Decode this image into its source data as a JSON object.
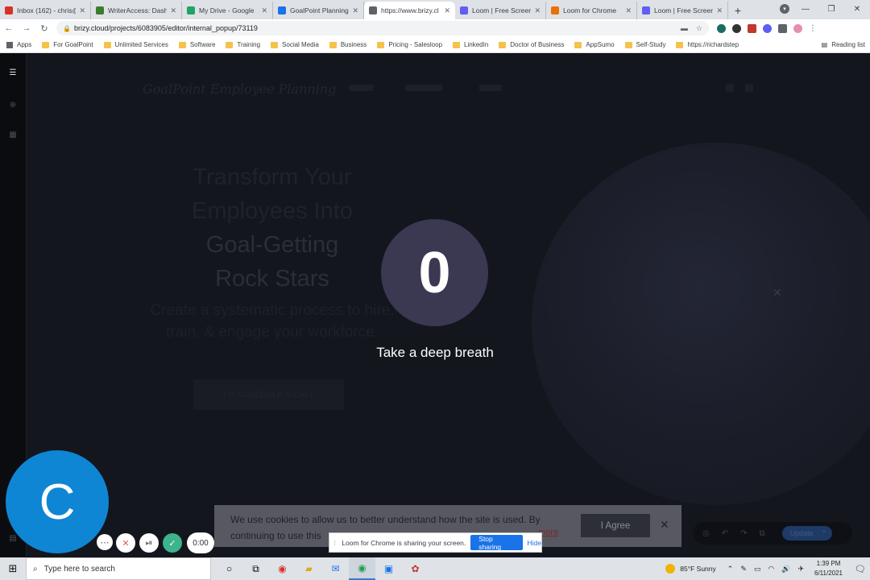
{
  "browser": {
    "tabs": [
      {
        "label": "Inbox (162) - chris@",
        "icon": "gmail-icon",
        "color": "#d93025",
        "active": false
      },
      {
        "label": "WriterAccess: Dash",
        "icon": "writeraccess-icon",
        "color": "#3a7d2c",
        "active": false
      },
      {
        "label": "My Drive - Google",
        "icon": "google-drive-icon",
        "color": "#1fa463",
        "active": false
      },
      {
        "label": "GoalPoint Planning",
        "icon": "calendar-icon",
        "color": "#1a73e8",
        "active": false
      },
      {
        "label": "https://www.brizy.cl",
        "icon": "brizy-icon",
        "color": "#5f6368",
        "active": true
      },
      {
        "label": "Loom | Free Screen",
        "icon": "loom-icon",
        "color": "#625df5",
        "active": false
      },
      {
        "label": "Loom for Chrome",
        "icon": "chrome-store-icon",
        "color": "#e8710a",
        "active": false
      },
      {
        "label": "Loom | Free Screen",
        "icon": "loom-icon",
        "color": "#625df5",
        "active": false
      }
    ],
    "url": "brizy.cloud/projects/6083905/editor/internal_popup/73119",
    "bookmarks": [
      "Apps",
      "For GoalPoint",
      "Unlimited Services",
      "Software",
      "Training",
      "Social Media",
      "Business",
      "Pricing - Salesloop",
      "LinkedIn",
      "Doctor of Business",
      "AppSumo",
      "Self-Study",
      "https://richardstep"
    ],
    "reading_list": "Reading list"
  },
  "editor": {
    "brand": "GoalPoint Employee Planning",
    "headline_lines": [
      "Transform Your",
      "Employees Into",
      "Goal-Getting",
      "Rock Stars"
    ],
    "subhead": "Create a systematic process to hire, train, & engage your workforce.",
    "cta": "TO SCHEDULE A CALL",
    "update_label": "Update"
  },
  "countdown": {
    "number": "0",
    "message": "Take a deep breath",
    "circle_color": "#3b3852"
  },
  "cookie": {
    "text": "We use cookies to allow us to better understand how the site is used. By continuing to use this",
    "link": "more",
    "agree": "I Agree"
  },
  "loom": {
    "share_message": "Loom for Chrome is sharing your screen.",
    "stop_label": "Stop sharing",
    "hide_label": "Hide",
    "avatar_letter": "C",
    "timer": "0:00",
    "brand_color": "#0e86d4"
  },
  "taskbar": {
    "search_placeholder": "Type here to search",
    "weather": "85°F  Sunny",
    "time": "1:39 PM",
    "date": "6/11/2021"
  }
}
